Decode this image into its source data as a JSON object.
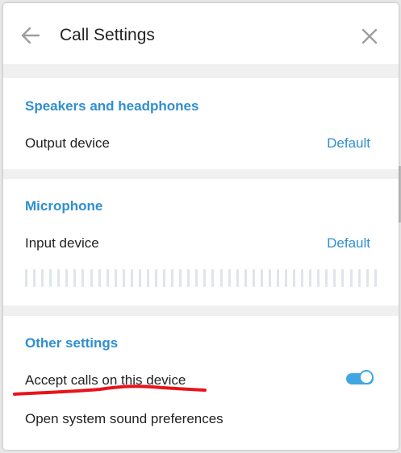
{
  "dialog": {
    "title": "Call Settings",
    "back_icon": "arrow-left-icon",
    "close_icon": "close-icon"
  },
  "speakers": {
    "title": "Speakers and headphones",
    "output_label": "Output device",
    "output_value": "Default"
  },
  "microphone": {
    "title": "Microphone",
    "input_label": "Input device",
    "input_value": "Default",
    "input_level": 0
  },
  "other": {
    "title": "Other settings",
    "accept_calls_label": "Accept calls on this device",
    "accept_calls_enabled": true,
    "sound_prefs_label": "Open system sound preferences"
  },
  "colors": {
    "accent": "#2f8fd0",
    "toggle_on": "#40a7e3",
    "annotation": "#e8141b"
  }
}
